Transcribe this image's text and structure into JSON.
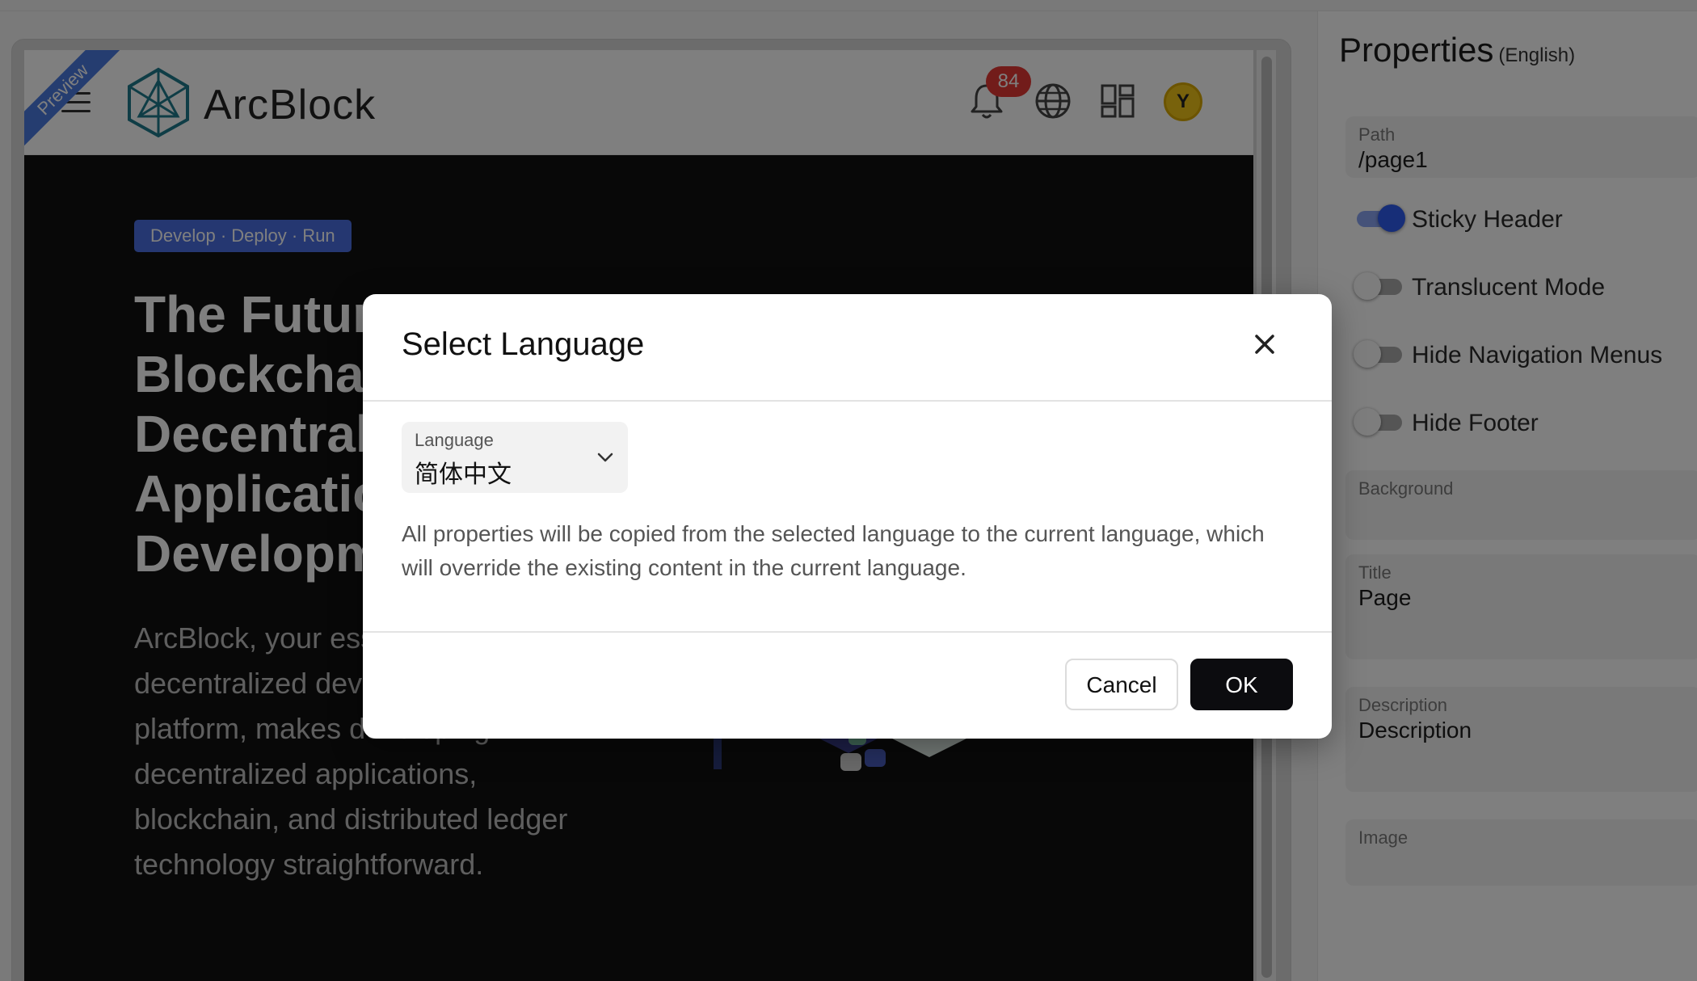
{
  "preview": {
    "ribbon_label": "Preview",
    "logo_text": "ArcBlock",
    "notification_count": "84",
    "avatar_initial": "Y",
    "tagline": "Develop · Deploy · Run",
    "hero_title": "The Future is Here: Blockchain and Decentralized Application Development",
    "hero_description": "ArcBlock, your essential decentralized development platform, makes developing decentralized applications, blockchain, and distributed ledger technology straightforward."
  },
  "properties": {
    "title": "Properties",
    "locale": "(English)",
    "path_label": "Path",
    "path_value": "/page1",
    "toggles": [
      {
        "label": "Sticky Header",
        "on": true
      },
      {
        "label": "Translucent Mode",
        "on": false
      },
      {
        "label": "Hide Navigation Menus",
        "on": false
      },
      {
        "label": "Hide Footer",
        "on": false
      }
    ],
    "background_label": "Background",
    "title_label": "Title",
    "title_value": "Page",
    "description_label": "Description",
    "description_value": "Description",
    "image_label": "Image"
  },
  "dialog": {
    "title": "Select Language",
    "language_label": "Language",
    "language_value": "简体中文",
    "message": "All properties will be copied from the selected language to the current language, which will override the existing content in the current language.",
    "cancel_label": "Cancel",
    "ok_label": "OK"
  },
  "colors": {
    "accent": "#2f5cf0",
    "badge": "#e53935",
    "ok_button": "#0c0c0f",
    "tagline_bg": "#4a6fe3"
  },
  "icons": [
    "menu-icon",
    "arcblock-logo-icon",
    "bell-icon",
    "globe-icon",
    "apps-grid-icon",
    "close-icon",
    "chevron-down-icon"
  ]
}
